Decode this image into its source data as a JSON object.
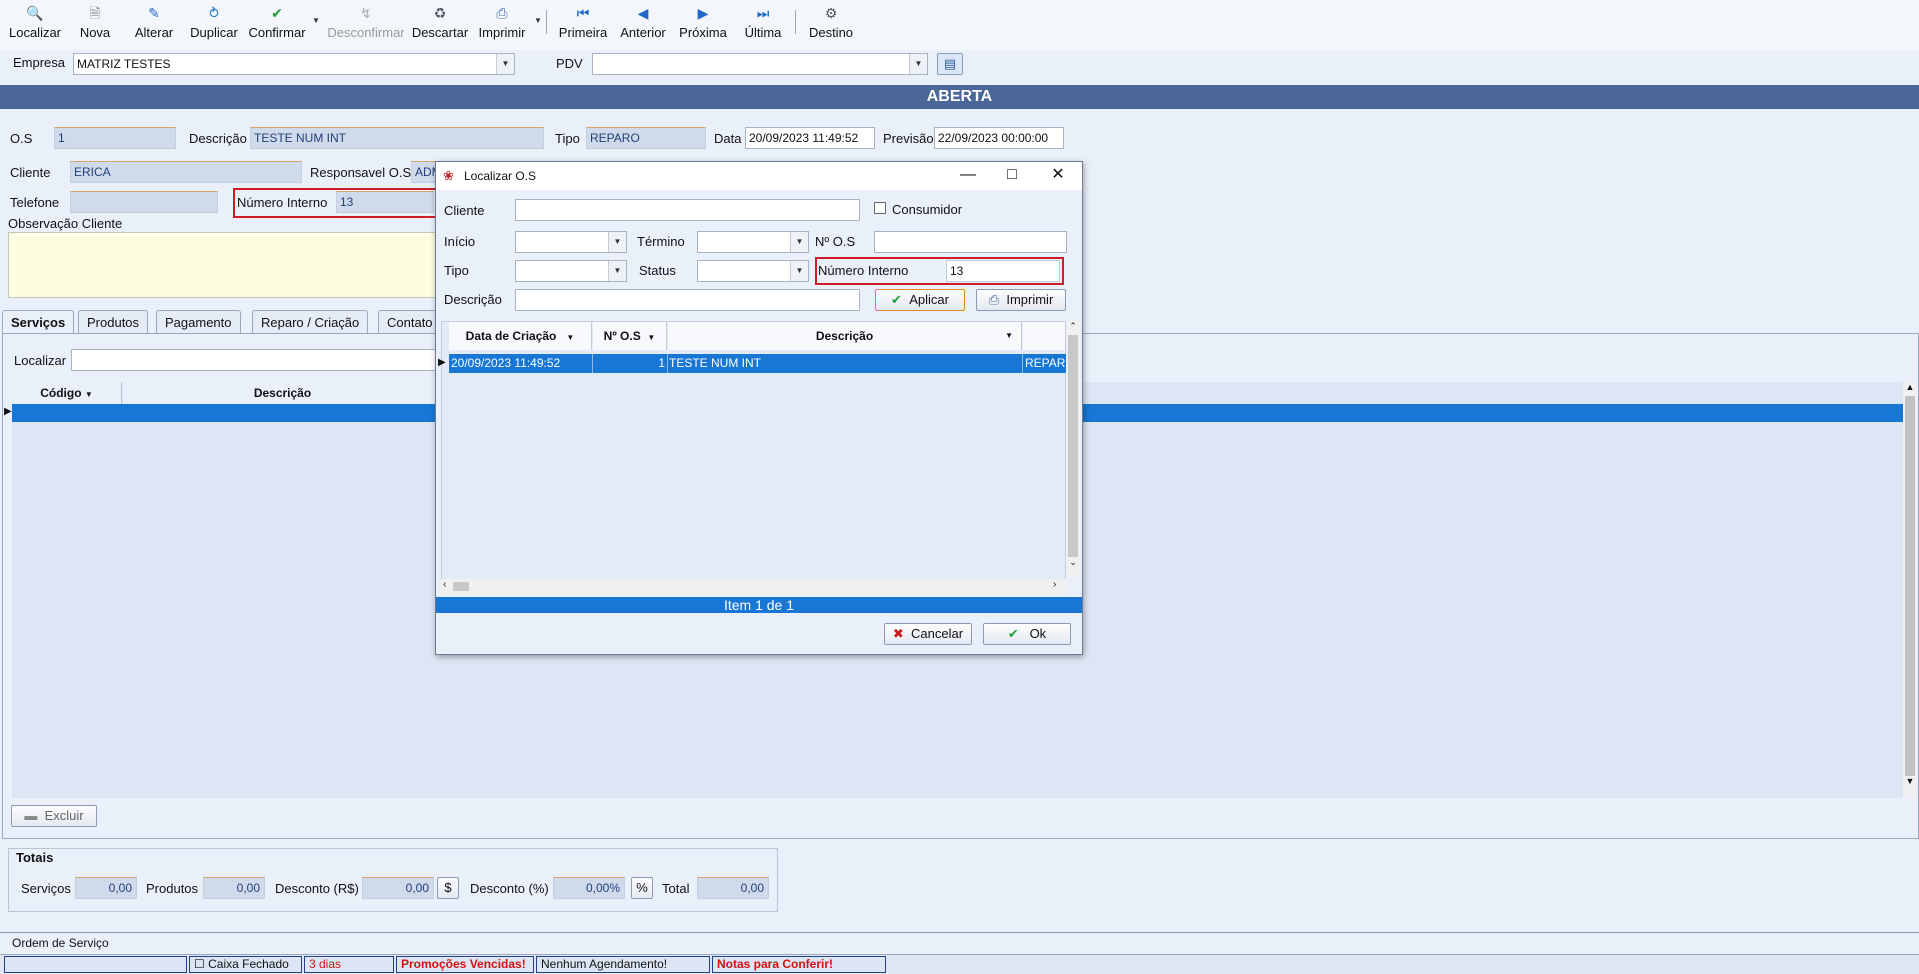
{
  "toolbar": {
    "localizar": "Localizar",
    "nova": "Nova",
    "alterar": "Alterar",
    "duplicar": "Duplicar",
    "confirmar": "Confirmar",
    "desconfirmar": "Desconfirmar",
    "descartar": "Descartar",
    "imprimir": "Imprimir",
    "primeira": "Primeira",
    "anterior": "Anterior",
    "proxima": "Próxima",
    "ultima": "Última",
    "destino": "Destino"
  },
  "header": {
    "empresa_label": "Empresa",
    "empresa_value": "MATRIZ TESTES",
    "pdv_label": "PDV",
    "pdv_value": ""
  },
  "status_band": "ABERTA",
  "form": {
    "os_label": "O.S",
    "os_value": "1",
    "descricao_label": "Descrição",
    "descricao_value": "TESTE NUM INT",
    "tipo_label": "Tipo",
    "tipo_value": "REPARO",
    "data_label": "Data",
    "data_value": "20/09/2023 11:49:52",
    "previsao_label": "Previsão",
    "previsao_value": "22/09/2023 00:00:00",
    "cliente_label": "Cliente",
    "cliente_value": "ERICA",
    "responsavel_label": "Responsavel O.S",
    "responsavel_value": "ADM",
    "telefone_label": "Telefone",
    "telefone_value": "",
    "numero_interno_label": "Número Interno",
    "numero_interno_value": "13",
    "observacao_label": "Observação Cliente"
  },
  "tabs": [
    "Serviços",
    "Produtos",
    "Pagamento",
    "Reparo / Criação",
    "Contato"
  ],
  "services": {
    "localizar_label": "Localizar",
    "col_codigo": "Código",
    "col_descricao": "Descrição",
    "excluir_label": "Excluir"
  },
  "totals": {
    "title": "Totais",
    "servicos_label": "Serviços",
    "servicos_value": "0,00",
    "produtos_label": "Produtos",
    "produtos_value": "0,00",
    "desconto_rs_label": "Desconto (R$)",
    "desconto_rs_value": "0,00",
    "desconto_pct_label": "Desconto (%)",
    "desconto_pct_value": "0,00%",
    "total_label": "Total",
    "total_value": "0,00"
  },
  "bottom_tab": "Ordem de Serviço",
  "statusbar": {
    "caixa": "Caixa Fechado",
    "dias": "3 dias",
    "promocoes": "Promoções Vencidas!",
    "agendamento": "Nenhum Agendamento!",
    "notas": "Notas para Conferir!"
  },
  "dialog": {
    "title": "Localizar O.S",
    "cliente_label": "Cliente",
    "cliente_value": "",
    "consumidor_label": "Consumidor",
    "inicio_label": "Início",
    "termino_label": "Término",
    "nos_label": "Nº O.S",
    "tipo_label": "Tipo",
    "status_label": "Status",
    "numero_interno_label": "Número Interno",
    "numero_interno_value": "13",
    "descricao_label": "Descrição",
    "aplicar_label": "Aplicar",
    "imprimir_label": "Imprimir",
    "grid_headers": [
      "Data de Criação",
      "Nº O.S",
      "Descrição"
    ],
    "row": {
      "data": "20/09/2023 11:49:52",
      "nos": "1",
      "descricao": "TESTE NUM INT",
      "tipo": "REPAR"
    },
    "item_count": "Item 1 de 1",
    "cancelar_label": "Cancelar",
    "ok_label": "Ok"
  },
  "colors": {
    "status_band": "#4a6797",
    "selection": "#1877d4",
    "highlight_box": "#d01c2a",
    "alert_text": "#d61010"
  }
}
